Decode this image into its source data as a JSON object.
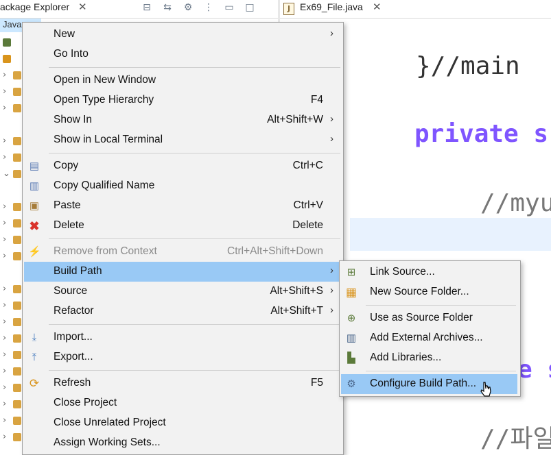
{
  "explorer": {
    "title": "ackage Explorer",
    "close_glyph": "✕",
    "selected_item": "Java"
  },
  "editor": {
    "tab_label": "Ex69_File.java",
    "tab_icon": "J",
    "close_glyph": "✕",
    "code_lines": [
      "}//main",
      "private s",
      "//myu",
      "e s",
      "//파일"
    ]
  },
  "context_menu": {
    "items": [
      {
        "label": "New",
        "accel": "",
        "submenu": true,
        "icon": ""
      },
      {
        "label": "Go Into",
        "accel": "",
        "submenu": false,
        "icon": ""
      },
      {
        "label": "Open in New Window",
        "accel": "",
        "submenu": false,
        "icon": ""
      },
      {
        "label": "Open Type Hierarchy",
        "accel": "F4",
        "submenu": false,
        "icon": ""
      },
      {
        "label": "Show In",
        "accel": "Alt+Shift+W",
        "submenu": true,
        "icon": ""
      },
      {
        "label": "Show in Local Terminal",
        "accel": "",
        "submenu": true,
        "icon": ""
      },
      {
        "label": "Copy",
        "accel": "Ctrl+C",
        "submenu": false,
        "icon": "copy-icon"
      },
      {
        "label": "Copy Qualified Name",
        "accel": "",
        "submenu": false,
        "icon": "copy-qualified-icon"
      },
      {
        "label": "Paste",
        "accel": "Ctrl+V",
        "submenu": false,
        "icon": "paste-icon"
      },
      {
        "label": "Delete",
        "accel": "Delete",
        "submenu": false,
        "icon": "delete-icon"
      },
      {
        "label": "Remove from Context",
        "accel": "Ctrl+Alt+Shift+Down",
        "submenu": false,
        "icon": "remove-context-icon",
        "disabled": true
      },
      {
        "label": "Build Path",
        "accel": "",
        "submenu": true,
        "icon": "",
        "highlighted": true
      },
      {
        "label": "Source",
        "accel": "Alt+Shift+S",
        "submenu": true,
        "icon": ""
      },
      {
        "label": "Refactor",
        "accel": "Alt+Shift+T",
        "submenu": true,
        "icon": ""
      },
      {
        "label": "Import...",
        "accel": "",
        "submenu": false,
        "icon": "import-icon"
      },
      {
        "label": "Export...",
        "accel": "",
        "submenu": false,
        "icon": "export-icon"
      },
      {
        "label": "Refresh",
        "accel": "F5",
        "submenu": false,
        "icon": "refresh-icon"
      },
      {
        "label": "Close Project",
        "accel": "",
        "submenu": false,
        "icon": ""
      },
      {
        "label": "Close Unrelated Project",
        "accel": "",
        "submenu": false,
        "icon": ""
      },
      {
        "label": "Assign Working Sets...",
        "accel": "",
        "submenu": false,
        "icon": ""
      }
    ],
    "submenu_arrow": "›"
  },
  "build_path_submenu": {
    "items": [
      {
        "label": "Link Source...",
        "icon": "link-source-icon"
      },
      {
        "label": "New Source Folder...",
        "icon": "new-source-folder-icon"
      },
      {
        "label": "Use as Source Folder",
        "icon": "use-source-folder-icon"
      },
      {
        "label": "Add External Archives...",
        "icon": "external-archive-icon"
      },
      {
        "label": "Add Libraries...",
        "icon": "libraries-icon"
      },
      {
        "label": "Configure Build Path...",
        "icon": "configure-build-path-icon",
        "highlighted": true
      }
    ]
  },
  "colors": {
    "menu_bg": "#f2f2f2",
    "highlight": "#99c9f5",
    "keyword": "#7f55ff"
  }
}
